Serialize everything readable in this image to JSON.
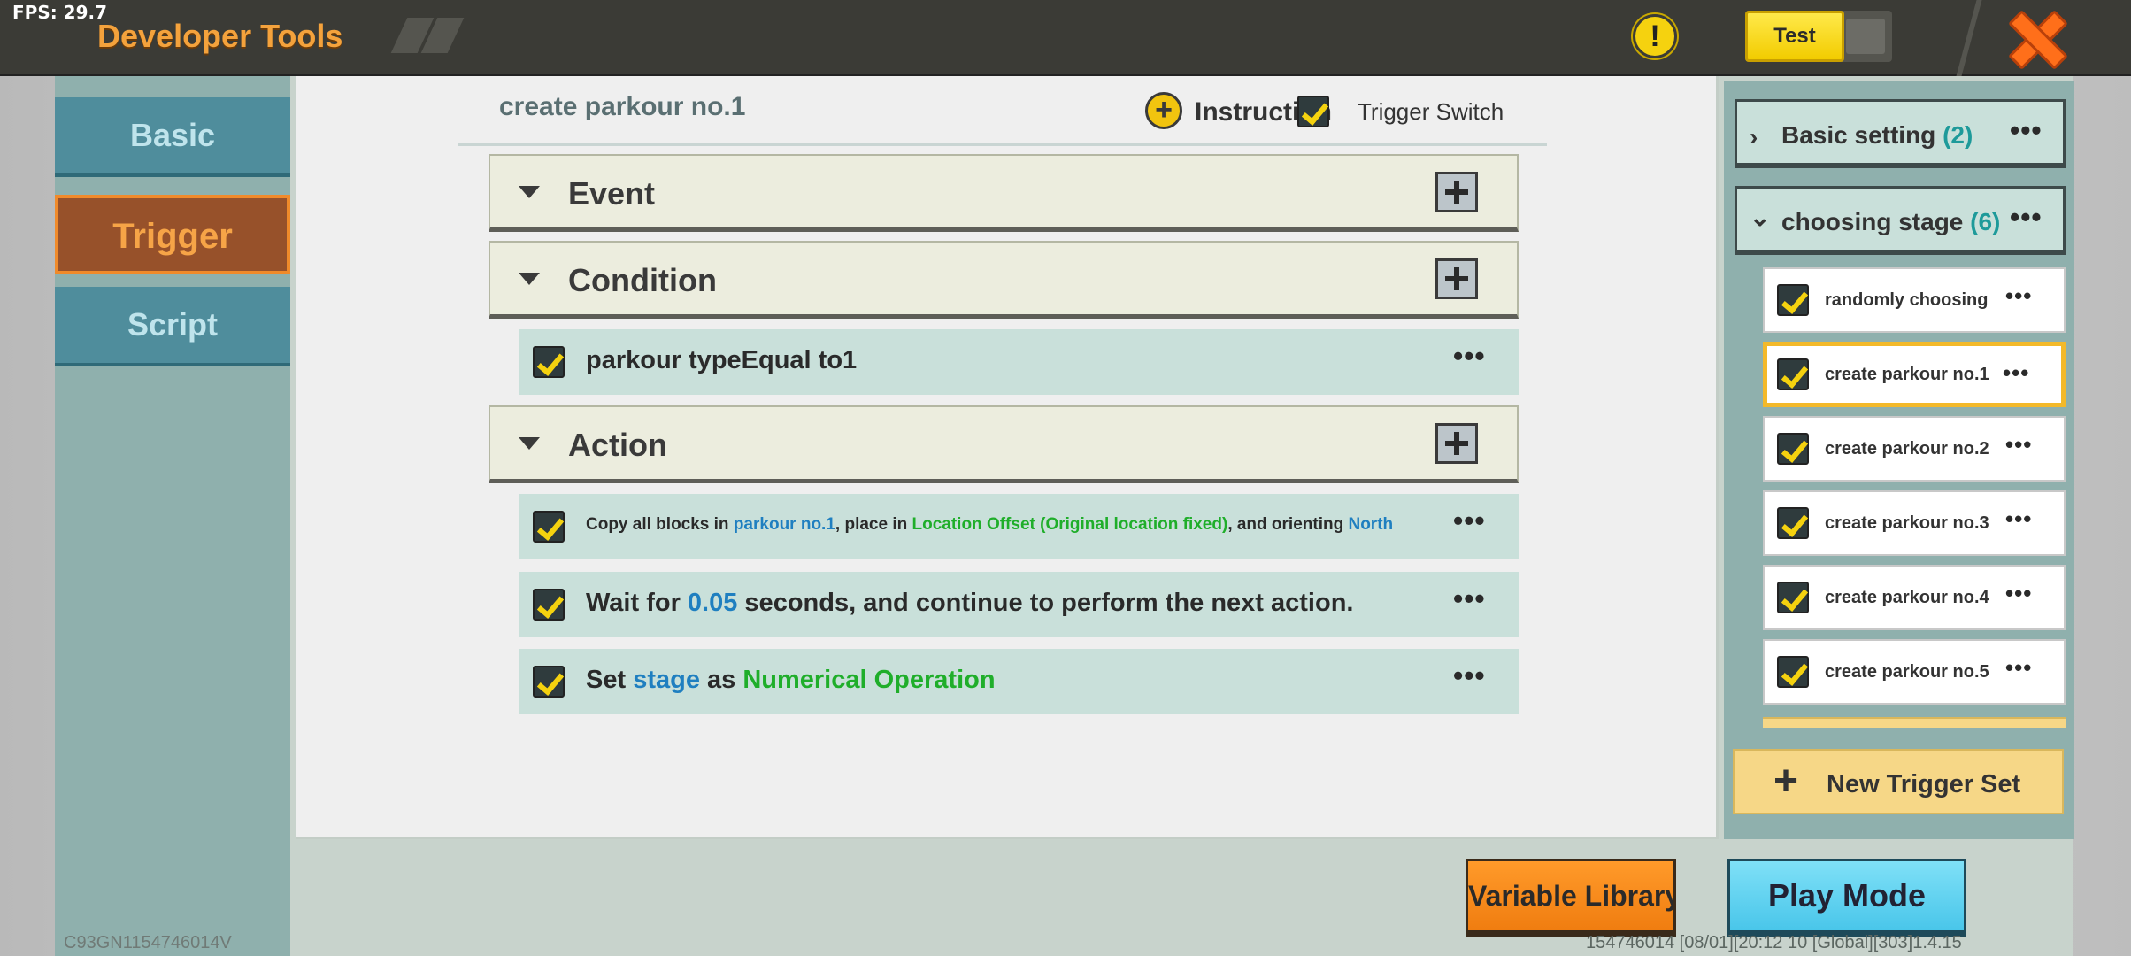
{
  "topbar": {
    "fps": "FPS: 29.7",
    "title": "Developer Tools",
    "test_label": "Test"
  },
  "nav": {
    "basic": "Basic",
    "trigger": "Trigger",
    "script": "Script"
  },
  "editor": {
    "title": "create parkour no.1",
    "instruction_label": "Instruction",
    "trigger_switch_label": "Trigger Switch",
    "sections": {
      "event": "Event",
      "condition": "Condition",
      "action": "Action"
    },
    "condition_rows": [
      {
        "text": "parkour typeEqual to1"
      }
    ],
    "action_rows": [
      {
        "p1": "Copy all blocks in ",
        "v1": "parkour no.1",
        "p2": ", place in ",
        "v2": "Location Offset (Original location fixed)",
        "p3": ", and orienting ",
        "v3": "North"
      },
      {
        "p1": "Wait for ",
        "v1": "0.05",
        "p2": " seconds, and continue to perform the next action."
      },
      {
        "p1": "Set ",
        "v1": "stage",
        "p2": " as ",
        "v2": "Numerical Operation"
      }
    ]
  },
  "trigger_sets": {
    "groups": [
      {
        "name": "Basic setting ",
        "count": "(2)",
        "chevron": "›"
      },
      {
        "name": "choosing stage ",
        "count": "(6)",
        "chevron": "⌄"
      }
    ],
    "items": [
      "randomly choosing",
      "create parkour no.1",
      "create parkour no.2",
      "create parkour no.3",
      "create parkour no.4",
      "create parkour no.5"
    ],
    "selected_index": 1,
    "new_trigger_label": "New Trigger Set"
  },
  "bottom": {
    "variable_library": "Variable Library",
    "play_mode": "Play Mode",
    "footer_left": "C93GN1154746014V",
    "footer_right": "154746014   [08/01][20:12 10  [Global][303]1.4.15"
  },
  "colors": {
    "accent_orange": "#f4a23c",
    "check_yellow": "#f5d20f",
    "value_blue": "#1f7fc0",
    "value_green": "#1fae2a",
    "count_teal": "#1e9a9a"
  },
  "dots_glyph": "•••"
}
